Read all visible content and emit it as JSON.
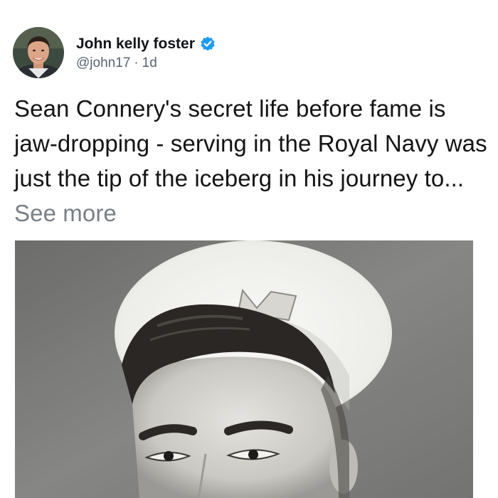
{
  "post": {
    "author_name": "John kelly foster",
    "verified_icon": "verified-badge-icon",
    "handle": "@john17",
    "separator": "·",
    "time": "1d",
    "text": "Sean Connery's secret life before fame is jaw-dropping - serving in the Royal Navy was just the tip of the iceberg in his journey to...",
    "see_more": "See more",
    "colors": {
      "verified": "#1d9bf0",
      "name": "#111418",
      "meta": "#566370",
      "see_more": "#7a7f85"
    }
  }
}
